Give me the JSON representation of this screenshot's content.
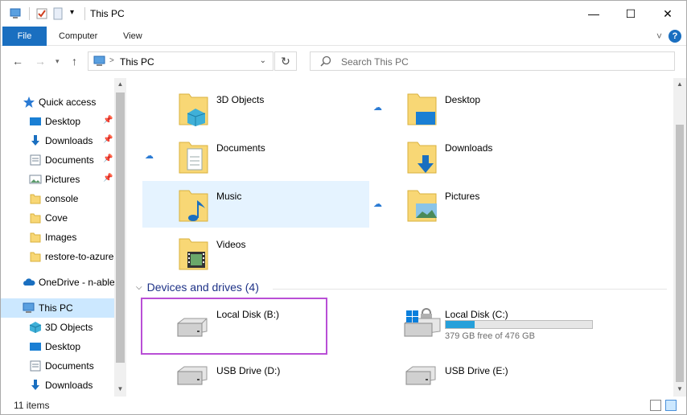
{
  "window": {
    "title": "This PC",
    "minimize_glyph": "—",
    "maximize_glyph": "☐",
    "close_glyph": "✕"
  },
  "ribbon": {
    "tabs": [
      "File",
      "Computer",
      "View"
    ],
    "help_label": "?",
    "collapse_glyph": "˅"
  },
  "address_bar": {
    "path": "This PC",
    "separator": ">",
    "search_placeholder": "Search This PC"
  },
  "sidebar": {
    "items": [
      {
        "label": "Quick access",
        "icon": "star-icon"
      },
      {
        "label": "Desktop",
        "icon": "desktop-icon",
        "pinned": true
      },
      {
        "label": "Downloads",
        "icon": "download-icon",
        "pinned": true
      },
      {
        "label": "Documents",
        "icon": "documents-icon",
        "pinned": true
      },
      {
        "label": "Pictures",
        "icon": "pictures-icon",
        "pinned": true
      },
      {
        "label": "console",
        "icon": "folder-icon"
      },
      {
        "label": "Cove",
        "icon": "folder-icon"
      },
      {
        "label": "Images",
        "icon": "folder-icon"
      },
      {
        "label": "restore-to-azure",
        "icon": "folder-icon"
      },
      {
        "label": "OneDrive - n-able",
        "icon": "onedrive-icon"
      },
      {
        "label": "This PC",
        "icon": "pc-icon",
        "selected": true
      },
      {
        "label": "3D Objects",
        "icon": "3d-objects-icon"
      },
      {
        "label": "Desktop",
        "icon": "desktop-icon"
      },
      {
        "label": "Documents",
        "icon": "documents-icon"
      },
      {
        "label": "Downloads",
        "icon": "download-icon"
      }
    ]
  },
  "folders": [
    {
      "name": "3D Objects",
      "icon": "3d-objects-folder-icon"
    },
    {
      "name": "Desktop",
      "icon": "desktop-folder-icon"
    },
    {
      "name": "Documents",
      "icon": "documents-folder-icon"
    },
    {
      "name": "Downloads",
      "icon": "downloads-folder-icon"
    },
    {
      "name": "Music",
      "icon": "music-folder-icon"
    },
    {
      "name": "Pictures",
      "icon": "pictures-folder-icon"
    },
    {
      "name": "Videos",
      "icon": "videos-folder-icon"
    }
  ],
  "devices_group": {
    "title": "Devices and drives (4)"
  },
  "drives": [
    {
      "name": "Local Disk (B:)",
      "icon": "hard-drive-icon"
    },
    {
      "name": "Local Disk (C:)",
      "icon": "windows-drive-icon",
      "free_text": "379 GB free of 476 GB",
      "used_fraction": 0.2
    },
    {
      "name": "USB Drive (D:)",
      "icon": "usb-drive-icon"
    },
    {
      "name": "USB Drive (E:)",
      "icon": "usb-drive-icon"
    }
  ],
  "status_bar": {
    "item_count": "11 items"
  },
  "colors": {
    "accent": "#1a6fc0",
    "selection": "#cce8ff",
    "group_title": "#1e3287",
    "highlight_box": "#b94fd6",
    "drive_bar": "#26a0da"
  }
}
